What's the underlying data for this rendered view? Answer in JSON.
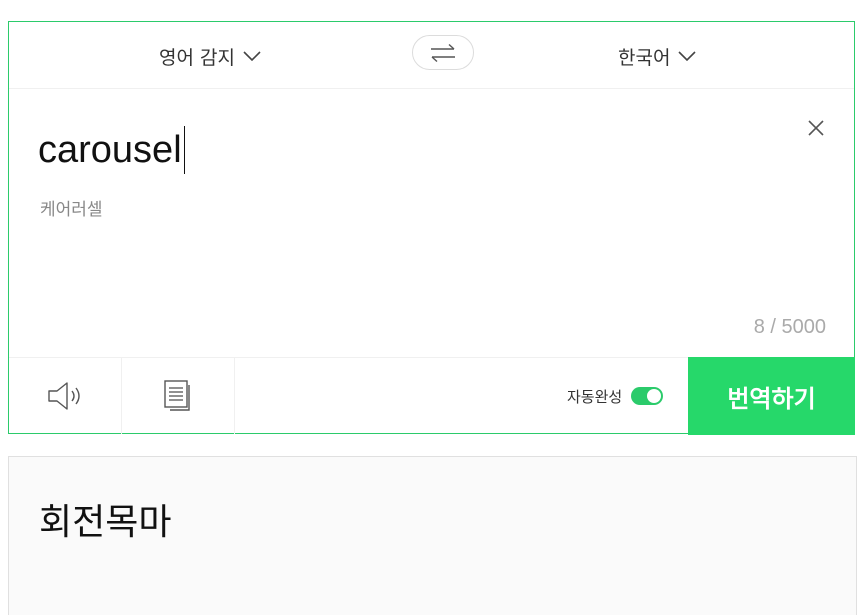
{
  "languages": {
    "source": "영어 감지",
    "target": "한국어",
    "swap_icon": "swap-arrows-icon"
  },
  "input": {
    "text": "carousel",
    "pronunciation": "케어러셀",
    "char_count": "8 / 5000",
    "clear_icon": "close-icon"
  },
  "toolbar": {
    "speak_icon": "speaker-icon",
    "copy_icon": "document-icon",
    "autocomplete_label": "자동완성",
    "autocomplete_on": true,
    "translate_label": "번역하기"
  },
  "output": {
    "text": "회전목마"
  },
  "colors": {
    "accent": "#26d86a",
    "border": "#2bcb6b"
  }
}
